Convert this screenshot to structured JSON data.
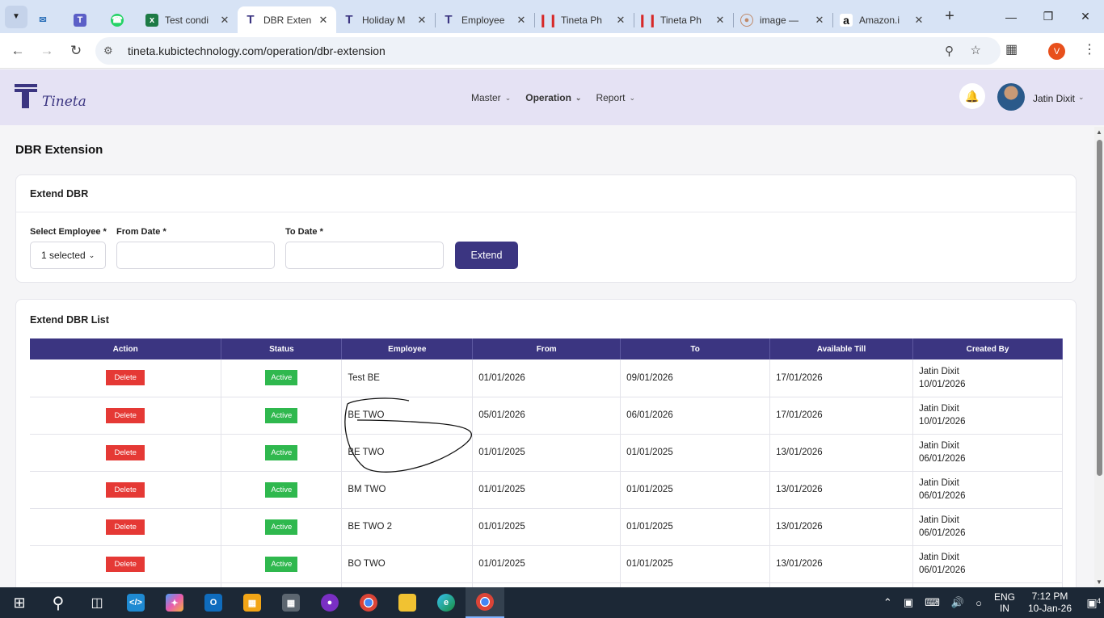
{
  "browser": {
    "tabs": [
      {
        "title": "",
        "icon": "mail-icon"
      },
      {
        "title": "",
        "icon": "teams-icon"
      },
      {
        "title": "",
        "icon": "whatsapp-icon"
      },
      {
        "title": "Test condi",
        "icon": "excel-icon"
      },
      {
        "title": "DBR Exten",
        "icon": "tineta-icon",
        "active": true
      },
      {
        "title": "Holiday M",
        "icon": "tineta-icon"
      },
      {
        "title": "Employee",
        "icon": "tineta-icon"
      },
      {
        "title": "Tineta Ph",
        "icon": "tineta-red-icon"
      },
      {
        "title": "Tineta Ph",
        "icon": "tineta-red-icon"
      },
      {
        "title": "image —",
        "icon": "image-icon"
      },
      {
        "title": "Amazon.i",
        "icon": "amazon-icon"
      }
    ],
    "url": "tineta.kubictechnology.com/operation/dbr-extension",
    "profile_initial": "V"
  },
  "app": {
    "logo_text": "Tineta",
    "nav": [
      {
        "label": "Master",
        "bold": false
      },
      {
        "label": "Operation",
        "bold": true
      },
      {
        "label": "Report",
        "bold": false
      }
    ],
    "user_name": "Jatin Dixit"
  },
  "page": {
    "title": "DBR Extension",
    "extend_card": {
      "title": "Extend DBR",
      "employee_label": "Select Employee *",
      "employee_value": "1 selected",
      "from_label": "From Date *",
      "from_value": "",
      "to_label": "To Date *",
      "to_value": "",
      "button": "Extend"
    },
    "list_card": {
      "title": "Extend DBR List",
      "columns": [
        "Action",
        "Status",
        "Employee",
        "From",
        "To",
        "Available Till",
        "Created By"
      ],
      "rows": [
        {
          "action": "Delete",
          "status": "Active",
          "employee": "Test BE",
          "from": "01/01/2026",
          "to": "09/01/2026",
          "available_till": "17/01/2026",
          "created_by": "Jatin Dixit",
          "created_on": "10/01/2026"
        },
        {
          "action": "Delete",
          "status": "Active",
          "employee": "BE TWO",
          "from": "05/01/2026",
          "to": "06/01/2026",
          "available_till": "17/01/2026",
          "created_by": "Jatin Dixit",
          "created_on": "10/01/2026"
        },
        {
          "action": "Delete",
          "status": "Active",
          "employee": "BE TWO",
          "from": "01/01/2025",
          "to": "01/01/2025",
          "available_till": "13/01/2026",
          "created_by": "Jatin Dixit",
          "created_on": "06/01/2026"
        },
        {
          "action": "Delete",
          "status": "Active",
          "employee": "BM TWO",
          "from": "01/01/2025",
          "to": "01/01/2025",
          "available_till": "13/01/2026",
          "created_by": "Jatin Dixit",
          "created_on": "06/01/2026"
        },
        {
          "action": "Delete",
          "status": "Active",
          "employee": "BE TWO 2",
          "from": "01/01/2025",
          "to": "01/01/2025",
          "available_till": "13/01/2026",
          "created_by": "Jatin Dixit",
          "created_on": "06/01/2026"
        },
        {
          "action": "Delete",
          "status": "Active",
          "employee": "BO TWO",
          "from": "01/01/2025",
          "to": "01/01/2025",
          "available_till": "13/01/2026",
          "created_by": "Jatin Dixit",
          "created_on": "06/01/2026"
        }
      ]
    }
  },
  "taskbar": {
    "language": "ENG",
    "region": "IN",
    "time": "7:12 PM",
    "date": "10-Jan-26",
    "notifications": "4"
  },
  "colors": {
    "primary": "#3b3581",
    "header_bg": "#e5e2f4",
    "delete": "#e53935",
    "active": "#2fb84e"
  }
}
